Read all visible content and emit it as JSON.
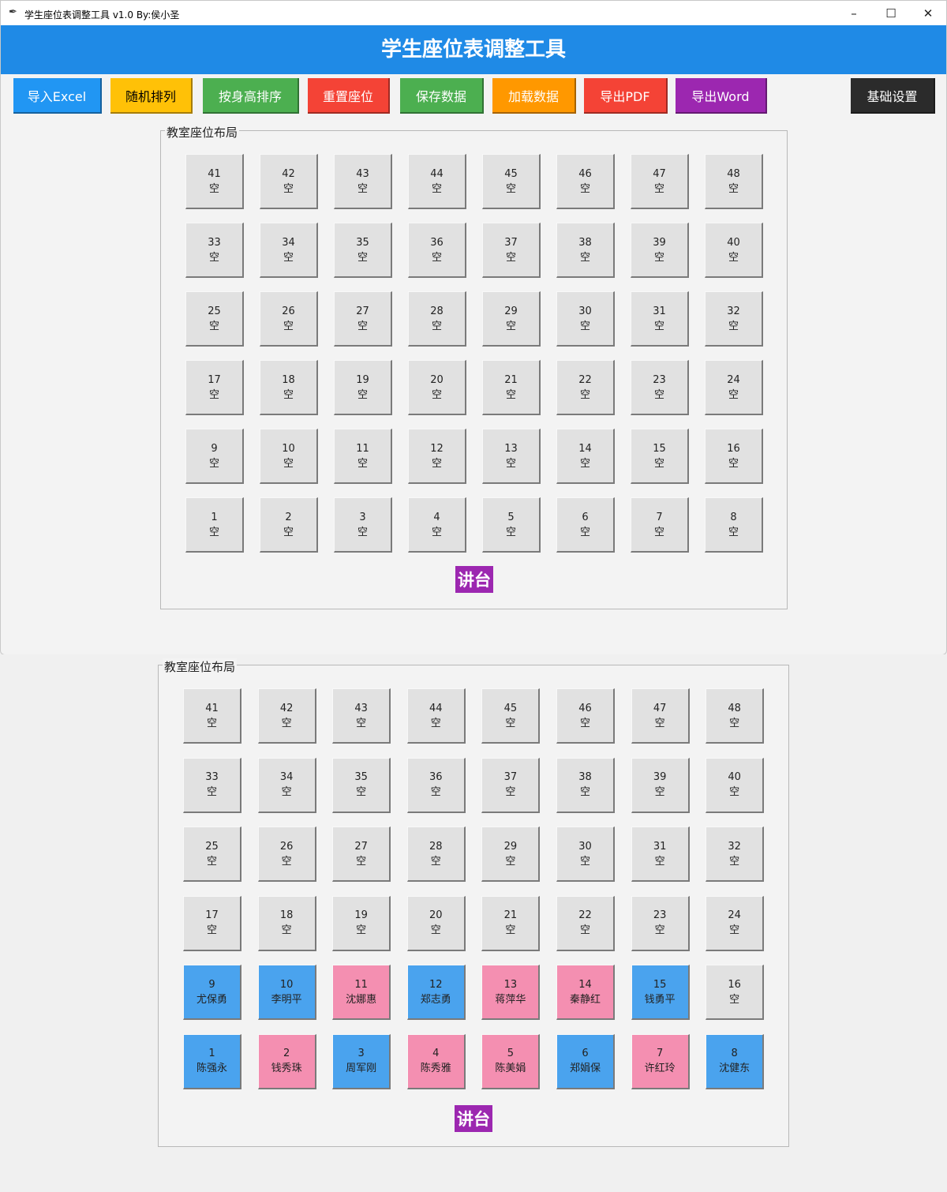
{
  "window": {
    "title": "学生座位表调整工具 v1.0 By:侯小圣",
    "controls": {
      "minimize": "–",
      "maximize": "☐",
      "close": "✕"
    }
  },
  "header": {
    "title": "学生座位表调整工具"
  },
  "toolbar": {
    "buttons": [
      {
        "label": "导入Excel",
        "color": "#2196f3",
        "text_color": "#ffffff"
      },
      {
        "label": "随机排列",
        "color": "#ffc107",
        "text_color": "#000000"
      },
      {
        "label": "按身高排序",
        "color": "#4caf50",
        "text_color": "#ffffff"
      },
      {
        "label": "重置座位",
        "color": "#f44336",
        "text_color": "#ffffff"
      },
      {
        "label": "保存数据",
        "color": "#4caf50",
        "text_color": "#ffffff"
      },
      {
        "label": "加载数据",
        "color": "#ff9800",
        "text_color": "#ffffff"
      },
      {
        "label": "导出PDF",
        "color": "#f44336",
        "text_color": "#ffffff"
      },
      {
        "label": "导出Word",
        "color": "#9c27b0",
        "text_color": "#ffffff"
      },
      {
        "label": "基础设置",
        "color": "#2b2b2b",
        "text_color": "#ffffff"
      }
    ]
  },
  "layout1": {
    "label": "教室座位布局",
    "podium": "讲台",
    "rows": [
      [
        {
          "n": "41",
          "t": "空",
          "g": ""
        },
        {
          "n": "42",
          "t": "空",
          "g": ""
        },
        {
          "n": "43",
          "t": "空",
          "g": ""
        },
        {
          "n": "44",
          "t": "空",
          "g": ""
        },
        {
          "n": "45",
          "t": "空",
          "g": ""
        },
        {
          "n": "46",
          "t": "空",
          "g": ""
        },
        {
          "n": "47",
          "t": "空",
          "g": ""
        },
        {
          "n": "48",
          "t": "空",
          "g": ""
        }
      ],
      [
        {
          "n": "33",
          "t": "空",
          "g": ""
        },
        {
          "n": "34",
          "t": "空",
          "g": ""
        },
        {
          "n": "35",
          "t": "空",
          "g": ""
        },
        {
          "n": "36",
          "t": "空",
          "g": ""
        },
        {
          "n": "37",
          "t": "空",
          "g": ""
        },
        {
          "n": "38",
          "t": "空",
          "g": ""
        },
        {
          "n": "39",
          "t": "空",
          "g": ""
        },
        {
          "n": "40",
          "t": "空",
          "g": ""
        }
      ],
      [
        {
          "n": "25",
          "t": "空",
          "g": ""
        },
        {
          "n": "26",
          "t": "空",
          "g": ""
        },
        {
          "n": "27",
          "t": "空",
          "g": ""
        },
        {
          "n": "28",
          "t": "空",
          "g": ""
        },
        {
          "n": "29",
          "t": "空",
          "g": ""
        },
        {
          "n": "30",
          "t": "空",
          "g": ""
        },
        {
          "n": "31",
          "t": "空",
          "g": ""
        },
        {
          "n": "32",
          "t": "空",
          "g": ""
        }
      ],
      [
        {
          "n": "17",
          "t": "空",
          "g": ""
        },
        {
          "n": "18",
          "t": "空",
          "g": ""
        },
        {
          "n": "19",
          "t": "空",
          "g": ""
        },
        {
          "n": "20",
          "t": "空",
          "g": ""
        },
        {
          "n": "21",
          "t": "空",
          "g": ""
        },
        {
          "n": "22",
          "t": "空",
          "g": ""
        },
        {
          "n": "23",
          "t": "空",
          "g": ""
        },
        {
          "n": "24",
          "t": "空",
          "g": ""
        }
      ],
      [
        {
          "n": "9",
          "t": "空",
          "g": ""
        },
        {
          "n": "10",
          "t": "空",
          "g": ""
        },
        {
          "n": "11",
          "t": "空",
          "g": ""
        },
        {
          "n": "12",
          "t": "空",
          "g": ""
        },
        {
          "n": "13",
          "t": "空",
          "g": ""
        },
        {
          "n": "14",
          "t": "空",
          "g": ""
        },
        {
          "n": "15",
          "t": "空",
          "g": ""
        },
        {
          "n": "16",
          "t": "空",
          "g": ""
        }
      ],
      [
        {
          "n": "1",
          "t": "空",
          "g": ""
        },
        {
          "n": "2",
          "t": "空",
          "g": ""
        },
        {
          "n": "3",
          "t": "空",
          "g": ""
        },
        {
          "n": "4",
          "t": "空",
          "g": ""
        },
        {
          "n": "5",
          "t": "空",
          "g": ""
        },
        {
          "n": "6",
          "t": "空",
          "g": ""
        },
        {
          "n": "7",
          "t": "空",
          "g": ""
        },
        {
          "n": "8",
          "t": "空",
          "g": ""
        }
      ]
    ]
  },
  "layout2": {
    "label": "教室座位布局",
    "podium": "讲台",
    "rows": [
      [
        {
          "n": "41",
          "t": "空",
          "g": ""
        },
        {
          "n": "42",
          "t": "空",
          "g": ""
        },
        {
          "n": "43",
          "t": "空",
          "g": ""
        },
        {
          "n": "44",
          "t": "空",
          "g": ""
        },
        {
          "n": "45",
          "t": "空",
          "g": ""
        },
        {
          "n": "46",
          "t": "空",
          "g": ""
        },
        {
          "n": "47",
          "t": "空",
          "g": ""
        },
        {
          "n": "48",
          "t": "空",
          "g": ""
        }
      ],
      [
        {
          "n": "33",
          "t": "空",
          "g": ""
        },
        {
          "n": "34",
          "t": "空",
          "g": ""
        },
        {
          "n": "35",
          "t": "空",
          "g": ""
        },
        {
          "n": "36",
          "t": "空",
          "g": ""
        },
        {
          "n": "37",
          "t": "空",
          "g": ""
        },
        {
          "n": "38",
          "t": "空",
          "g": ""
        },
        {
          "n": "39",
          "t": "空",
          "g": ""
        },
        {
          "n": "40",
          "t": "空",
          "g": ""
        }
      ],
      [
        {
          "n": "25",
          "t": "空",
          "g": ""
        },
        {
          "n": "26",
          "t": "空",
          "g": ""
        },
        {
          "n": "27",
          "t": "空",
          "g": ""
        },
        {
          "n": "28",
          "t": "空",
          "g": ""
        },
        {
          "n": "29",
          "t": "空",
          "g": ""
        },
        {
          "n": "30",
          "t": "空",
          "g": ""
        },
        {
          "n": "31",
          "t": "空",
          "g": ""
        },
        {
          "n": "32",
          "t": "空",
          "g": ""
        }
      ],
      [
        {
          "n": "17",
          "t": "空",
          "g": ""
        },
        {
          "n": "18",
          "t": "空",
          "g": ""
        },
        {
          "n": "19",
          "t": "空",
          "g": ""
        },
        {
          "n": "20",
          "t": "空",
          "g": ""
        },
        {
          "n": "21",
          "t": "空",
          "g": ""
        },
        {
          "n": "22",
          "t": "空",
          "g": ""
        },
        {
          "n": "23",
          "t": "空",
          "g": ""
        },
        {
          "n": "24",
          "t": "空",
          "g": ""
        }
      ],
      [
        {
          "n": "9",
          "t": "尤保勇",
          "g": "male"
        },
        {
          "n": "10",
          "t": "李明平",
          "g": "male"
        },
        {
          "n": "11",
          "t": "沈娜惠",
          "g": "female"
        },
        {
          "n": "12",
          "t": "郑志勇",
          "g": "male"
        },
        {
          "n": "13",
          "t": "蒋萍华",
          "g": "female"
        },
        {
          "n": "14",
          "t": "秦静红",
          "g": "female"
        },
        {
          "n": "15",
          "t": "钱勇平",
          "g": "male"
        },
        {
          "n": "16",
          "t": "空",
          "g": ""
        }
      ],
      [
        {
          "n": "1",
          "t": "陈强永",
          "g": "male"
        },
        {
          "n": "2",
          "t": "钱秀珠",
          "g": "female"
        },
        {
          "n": "3",
          "t": "周军刚",
          "g": "male"
        },
        {
          "n": "4",
          "t": "陈秀雅",
          "g": "female"
        },
        {
          "n": "5",
          "t": "陈美娟",
          "g": "female"
        },
        {
          "n": "6",
          "t": "郑娟保",
          "g": "male"
        },
        {
          "n": "7",
          "t": "许红玲",
          "g": "female"
        },
        {
          "n": "8",
          "t": "沈健东",
          "g": "male"
        }
      ]
    ]
  }
}
